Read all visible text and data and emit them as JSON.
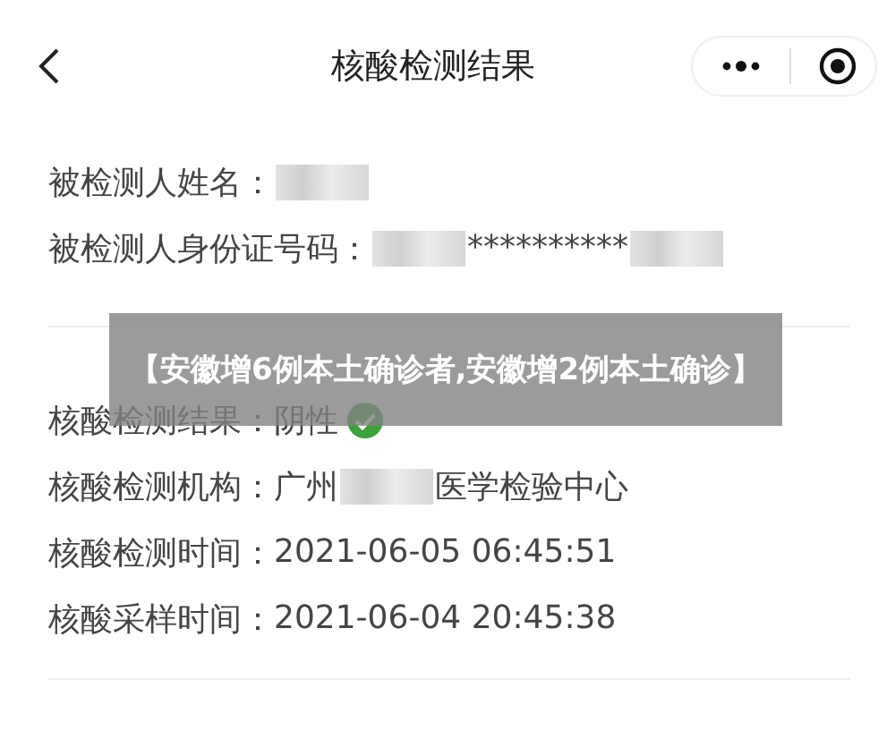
{
  "header": {
    "title": "核酸检测结果"
  },
  "person_rows": [
    {
      "label": "被检测人姓名：",
      "parts": [
        {
          "kind": "redacted"
        }
      ]
    },
    {
      "label": "被检测人身份证号码：",
      "parts": [
        {
          "kind": "redacted"
        },
        {
          "kind": "text",
          "text": "**********"
        },
        {
          "kind": "redacted"
        }
      ]
    }
  ],
  "result_rows": [
    {
      "label": "核酸检测结果：",
      "parts": [
        {
          "kind": "text",
          "text": "阴性"
        },
        {
          "kind": "check"
        }
      ]
    },
    {
      "label": "核酸检测机构：",
      "parts": [
        {
          "kind": "text",
          "text": "广州"
        },
        {
          "kind": "redacted"
        },
        {
          "kind": "text",
          "text": "医学检验中心"
        }
      ]
    },
    {
      "label": "核酸检测时间：",
      "parts": [
        {
          "kind": "text",
          "text": "2021-06-05 06:45:51"
        }
      ]
    },
    {
      "label": "核酸采样时间：",
      "parts": [
        {
          "kind": "text",
          "text": "2021-06-04 20:45:38"
        }
      ]
    }
  ],
  "banner": {
    "text": "【安徽增6例本土确诊者,安徽增2例本土确诊】"
  }
}
